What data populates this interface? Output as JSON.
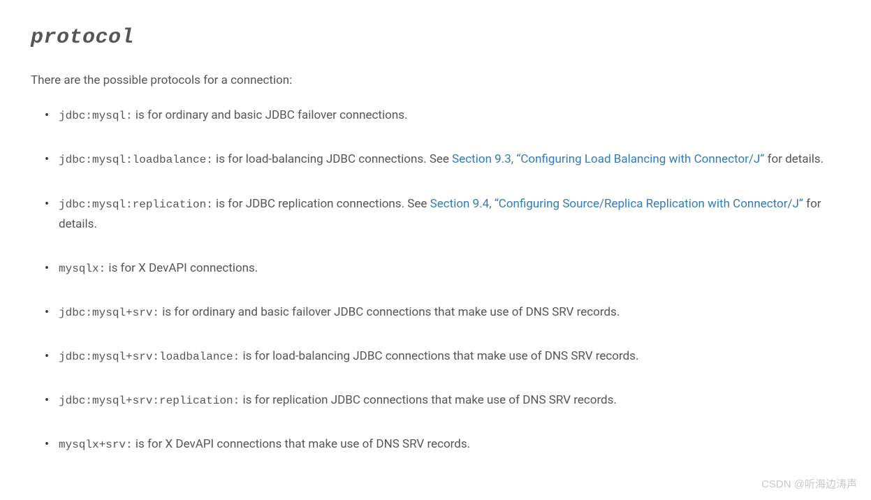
{
  "heading": "protocol",
  "intro": "There are the possible protocols for a connection:",
  "items": [
    {
      "code": "jdbc:mysql:",
      "text_before_link": " is for ordinary and basic JDBC failover connections.",
      "link": null,
      "text_after_link": ""
    },
    {
      "code": "jdbc:mysql:loadbalance:",
      "text_before_link": " is for load-balancing JDBC connections. See ",
      "link": "Section 9.3, “Configuring Load Balancing with Connector/J”",
      "text_after_link": " for details."
    },
    {
      "code": "jdbc:mysql:replication:",
      "text_before_link": " is for JDBC replication connections. See ",
      "link": "Section 9.4, “Configuring Source/Replica Replication with Connector/J”",
      "text_after_link": " for details."
    },
    {
      "code": "mysqlx:",
      "text_before_link": " is for X DevAPI connections.",
      "link": null,
      "text_after_link": ""
    },
    {
      "code": "jdbc:mysql+srv:",
      "text_before_link": " is for ordinary and basic failover JDBC connections that make use of DNS SRV records.",
      "link": null,
      "text_after_link": ""
    },
    {
      "code": "jdbc:mysql+srv:loadbalance:",
      "text_before_link": " is for load-balancing JDBC connections that make use of DNS SRV records.",
      "link": null,
      "text_after_link": ""
    },
    {
      "code": "jdbc:mysql+srv:replication:",
      "text_before_link": " is for replication JDBC connections that make use of DNS SRV records.",
      "link": null,
      "text_after_link": ""
    },
    {
      "code": "mysqlx+srv:",
      "text_before_link": " is for X DevAPI connections that make use of DNS SRV records.",
      "link": null,
      "text_after_link": ""
    }
  ],
  "watermark": "CSDN @听海边涛声"
}
